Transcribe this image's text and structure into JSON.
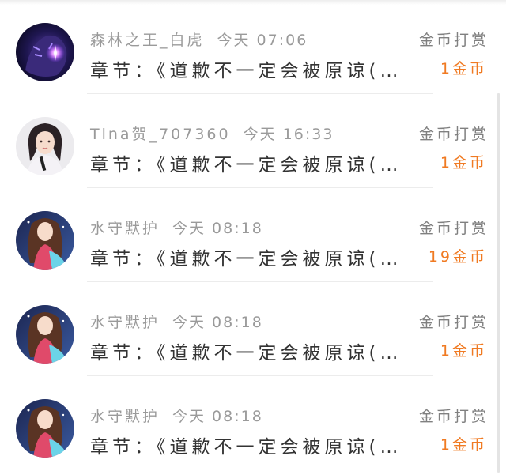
{
  "records": [
    {
      "avatar_icon": "purple-tiger-avatar",
      "username": "森林之王_白虎",
      "time": "今天 07:06",
      "chapter": "章节：《道歉不一定会被原谅(…",
      "reward_type": "金币打赏",
      "amount": "1金币"
    },
    {
      "avatar_icon": "girl-with-microphone-avatar",
      "username": "Tlna贺_707360",
      "time": "今天 16:33",
      "chapter": "章节：《道歉不一定会被原谅(…",
      "reward_type": "金币打赏",
      "amount": "1金币"
    },
    {
      "avatar_icon": "anime-girl-avatar",
      "username": "水守默护",
      "time": "今天 08:18",
      "chapter": "章节：《道歉不一定会被原谅(…",
      "reward_type": "金币打赏",
      "amount": "19金币"
    },
    {
      "avatar_icon": "anime-girl-avatar",
      "username": "水守默护",
      "time": "今天 08:18",
      "chapter": "章节：《道歉不一定会被原谅(…",
      "reward_type": "金币打赏",
      "amount": "1金币"
    },
    {
      "avatar_icon": "anime-girl-avatar",
      "username": "水守默护",
      "time": "今天 08:18",
      "chapter": "章节：《道歉不一定会被原谅(…",
      "reward_type": "金币打赏",
      "amount": "1金币"
    }
  ],
  "colors": {
    "amount": "#f07a22",
    "meta_text": "#9a9a9a",
    "chapter_text": "#333333"
  }
}
